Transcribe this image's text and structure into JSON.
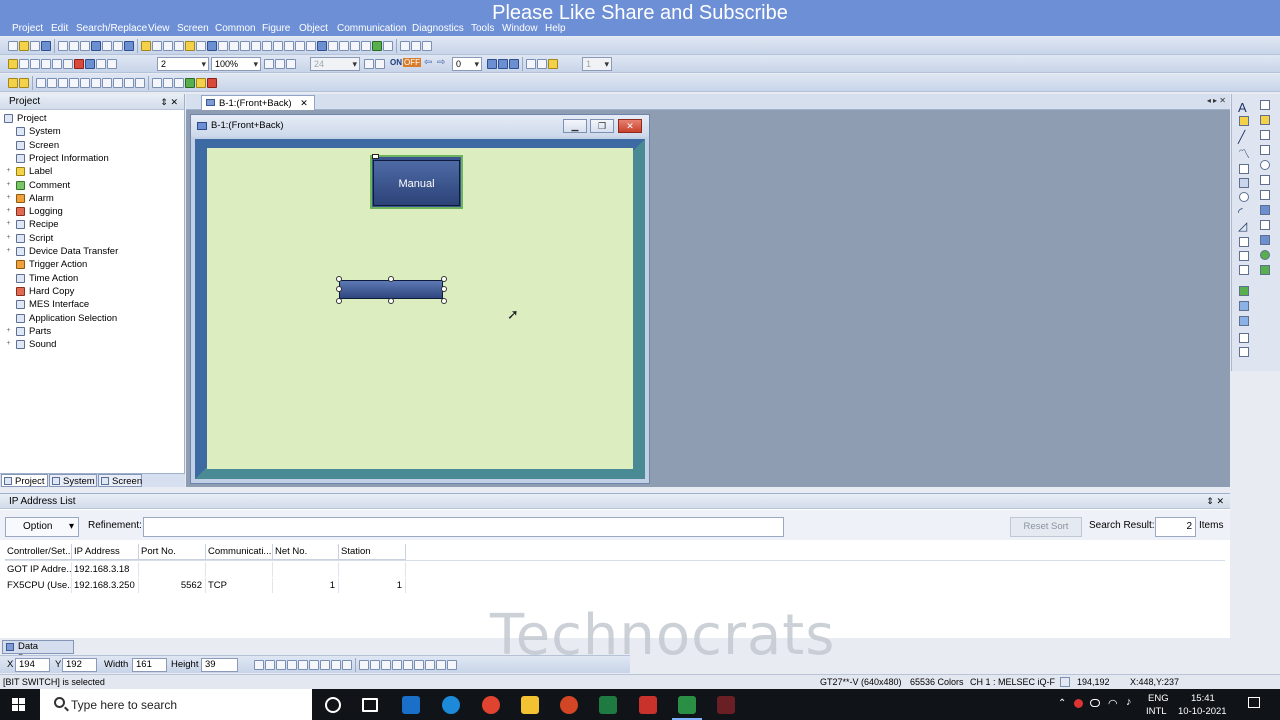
{
  "overlay_title": "Please Like Share and Subscribe",
  "menu": [
    "Project",
    "Edit",
    "Search/Replace",
    "View",
    "Screen",
    "Common",
    "Figure",
    "Object",
    "Communication",
    "Diagnostics",
    "Tools",
    "Window",
    "Help"
  ],
  "toolbar": {
    "layer_value": "2",
    "zoom_value": "100%",
    "font_size_value": "24",
    "on_label": "ON",
    "off_label": "OFF",
    "state_value": "0",
    "page_value": "1"
  },
  "project_panel": {
    "title": "Project",
    "tree": [
      {
        "label": "Project",
        "level": 0,
        "expander": "-",
        "icon": "project"
      },
      {
        "label": "System",
        "level": 1,
        "expander": "",
        "icon": "system"
      },
      {
        "label": "Screen",
        "level": 1,
        "expander": "",
        "icon": "screen"
      },
      {
        "label": "Project Information",
        "level": 1,
        "expander": "",
        "icon": "info"
      },
      {
        "label": "Label",
        "level": 1,
        "expander": "+",
        "icon": "label"
      },
      {
        "label": "Comment",
        "level": 1,
        "expander": "+",
        "icon": "comment"
      },
      {
        "label": "Alarm",
        "level": 1,
        "expander": "+",
        "icon": "alarm"
      },
      {
        "label": "Logging",
        "level": 1,
        "expander": "+",
        "icon": "logging"
      },
      {
        "label": "Recipe",
        "level": 1,
        "expander": "+",
        "icon": "recipe"
      },
      {
        "label": "Script",
        "level": 1,
        "expander": "+",
        "icon": "script"
      },
      {
        "label": "Device Data Transfer",
        "level": 1,
        "expander": "+",
        "icon": "transfer"
      },
      {
        "label": "Trigger Action",
        "level": 1,
        "expander": "",
        "icon": "trigger"
      },
      {
        "label": "Time Action",
        "level": 1,
        "expander": "",
        "icon": "time"
      },
      {
        "label": "Hard Copy",
        "level": 1,
        "expander": "",
        "icon": "hardcopy"
      },
      {
        "label": "MES Interface",
        "level": 1,
        "expander": "",
        "icon": "mes"
      },
      {
        "label": "Application Selection",
        "level": 1,
        "expander": "",
        "icon": "app"
      },
      {
        "label": "Parts",
        "level": 1,
        "expander": "+",
        "icon": "parts"
      },
      {
        "label": "Sound",
        "level": 1,
        "expander": "+",
        "icon": "sound"
      }
    ],
    "tabs": [
      "Project",
      "System",
      "Screen"
    ]
  },
  "document_tab": "B-1:(Front+Back)",
  "mdi_window": {
    "title": "B-1:(Front+Back)",
    "manual_button_label": "Manual"
  },
  "ip_panel": {
    "title": "IP Address List",
    "option_label": "Option",
    "refinement_label": "Refinement:",
    "refinement_value": "",
    "reset_sort_label": "Reset Sort",
    "search_result_label": "Search Result:",
    "search_result_count": "2",
    "items_label": "Items",
    "columns": [
      "Controller/Set...",
      "IP Address",
      "Port No.",
      "Communicati...",
      "Net No.",
      "Station"
    ],
    "rows": [
      [
        "GOT IP Addre...",
        "192.168.3.18",
        "",
        "",
        "",
        ""
      ],
      [
        "FX5CPU (Use...",
        "192.168.3.250",
        "5562",
        "TCP",
        "1",
        "1"
      ]
    ]
  },
  "watermark": "Technocrats",
  "data_browser_tab": "Data Browser",
  "properties": {
    "x_label": "X",
    "x_value": "194",
    "y_label": "Y",
    "y_value": "192",
    "width_label": "Width",
    "width_value": "161",
    "height_label": "Height",
    "height_value": "39"
  },
  "status": {
    "message": "[BIT SWITCH] is selected",
    "device": "GT27**-V (640x480)",
    "colors": "65536 Colors",
    "channel": "CH 1 : MELSEC iQ-F",
    "position": "194,192",
    "cursor_pos": "X:448,Y:237"
  },
  "taskbar": {
    "search_placeholder": "Type here to search",
    "lang_top": "ENG",
    "lang_bottom": "INTL",
    "time": "15:41",
    "date": "10-10-2021"
  }
}
